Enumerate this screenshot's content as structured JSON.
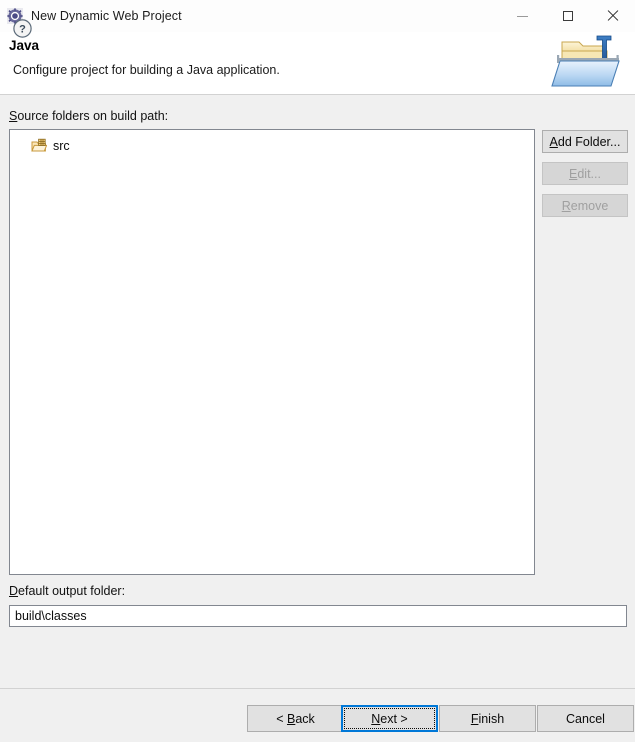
{
  "window": {
    "title": "New Dynamic Web Project",
    "icon": "eclipse-wizard-icon",
    "controls": {
      "minimize": "minimize-icon",
      "maximize": "maximize-icon",
      "close": "close-icon"
    }
  },
  "header": {
    "title": "Java",
    "description": "Configure project for building a Java application.",
    "banner_icon": "java-folder-icon"
  },
  "content": {
    "source_label_prefix": "S",
    "source_label_rest": "ource folders on build path:",
    "tree": {
      "items": [
        {
          "label": "src",
          "icon": "source-folder-icon"
        }
      ]
    },
    "side_buttons": [
      {
        "label_prefix": "A",
        "label_rest": "dd Folder...",
        "enabled": true,
        "name": "add-folder-button"
      },
      {
        "label_prefix": "E",
        "label_rest": "dit...",
        "enabled": false,
        "name": "edit-button"
      },
      {
        "label_prefix": "R",
        "label_rest": "emove",
        "enabled": false,
        "name": "remove-button"
      }
    ],
    "output_label_prefix": "D",
    "output_label_rest": "efault output folder:",
    "output_value": "build\\classes"
  },
  "footer": {
    "help_icon": "help-icon",
    "buttons": {
      "back": {
        "pre": "< ",
        "accel": "B",
        "post": "ack"
      },
      "next": {
        "pre": "",
        "accel": "N",
        "post": "ext >"
      },
      "finish": {
        "pre": "",
        "accel": "F",
        "post": "inish"
      },
      "cancel": {
        "pre": "",
        "accel": "",
        "post": "Cancel"
      }
    }
  },
  "colors": {
    "dialog_bg": "#f0f0f0",
    "field_bg": "#ffffff",
    "border": "#828790",
    "focus_blue": "#0078d7",
    "button_bg": "#e1e1e1",
    "disabled_text": "#a0a0a0"
  }
}
